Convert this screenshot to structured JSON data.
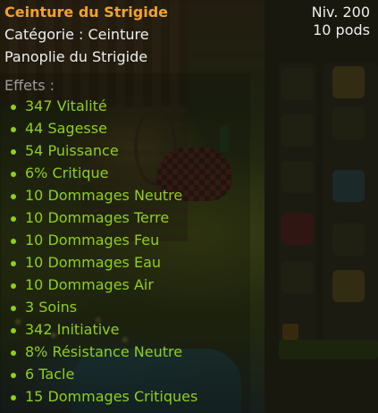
{
  "tooltip": {
    "title": "Ceinture du Strigide",
    "category": "Catégorie : Ceinture",
    "set": "Panoplie du Strigide",
    "level": "Niv. 200",
    "pods": "10 pods",
    "effects_label": "Effets :",
    "effects": [
      "347 Vitalité",
      "44 Sagesse",
      "54 Puissance",
      "6% Critique",
      "10 Dommages Neutre",
      "10 Dommages Terre",
      "10 Dommages Feu",
      "10 Dommages Eau",
      "10 Dommages Air",
      "3 Soins",
      "342 Initiative",
      "8% Résistance Neutre",
      "6 Tacle",
      "15 Dommages Critiques"
    ],
    "colors": {
      "title": "#f2a22b",
      "effect": "#8fcf1e",
      "label": "#9c9c9c",
      "text": "#eeeeee"
    }
  }
}
